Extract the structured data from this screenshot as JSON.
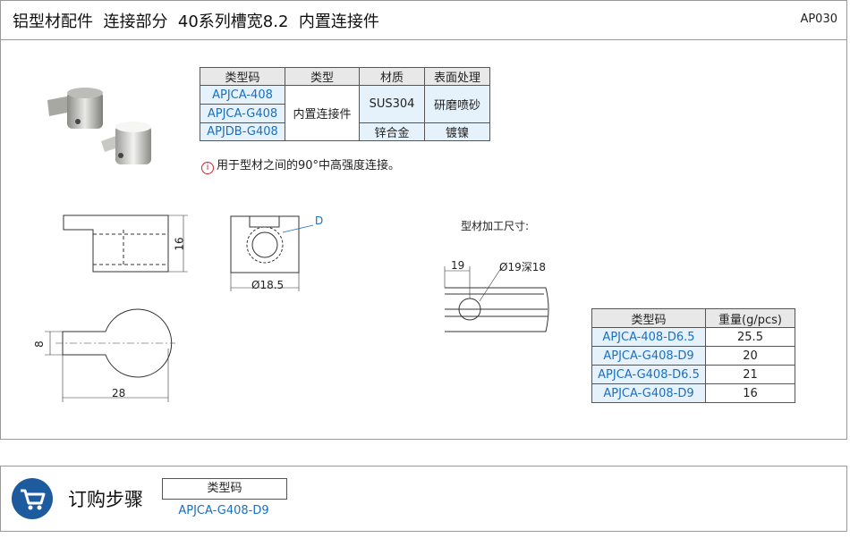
{
  "header": {
    "title": "铝型材配件  连接部分  40系列槽宽8.2  内置连接件",
    "code": "AP030"
  },
  "spec_table": {
    "headers": [
      "类型码",
      "类型",
      "材质",
      "表面处理"
    ],
    "type_codes": [
      "APJCA-408",
      "APJCA-G408",
      "APJDB-G408"
    ],
    "type": "内置连接件",
    "materials": [
      "SUS304",
      "锌合金"
    ],
    "finishes": [
      "研磨喷砂",
      "镀镍"
    ]
  },
  "note": {
    "icon": "i",
    "text": "用于型材之间的90°中高强度连接。"
  },
  "drawing": {
    "dim_16": "16",
    "dim_18_5": "Ø18.5",
    "dim_d": "D",
    "dim_8": "8",
    "dim_28": "28",
    "mount_title": "型材加工尺寸:",
    "dim_19": "19",
    "dim_hole": "Ø19深18"
  },
  "weight_table": {
    "headers": [
      "类型码",
      "重量(g/pcs)"
    ],
    "rows": [
      {
        "code": "APJCA-408-D6.5",
        "weight": "25.5"
      },
      {
        "code": "APJCA-G408-D9",
        "weight": "20"
      },
      {
        "code": "APJCA-G408-D6.5",
        "weight": "21"
      },
      {
        "code": "APJCA-G408-D9",
        "weight": "16"
      }
    ]
  },
  "order": {
    "title": "订购步骤",
    "box_label": "类型码",
    "value": "APJCA-G408-D9"
  },
  "colors": {
    "accent_blue": "#1a6fc0",
    "cart_blue": "#1d5b9e",
    "cell_blue": "#e6f2fb",
    "header_gray": "#e8e8e8",
    "note_red": "#d0262b"
  }
}
